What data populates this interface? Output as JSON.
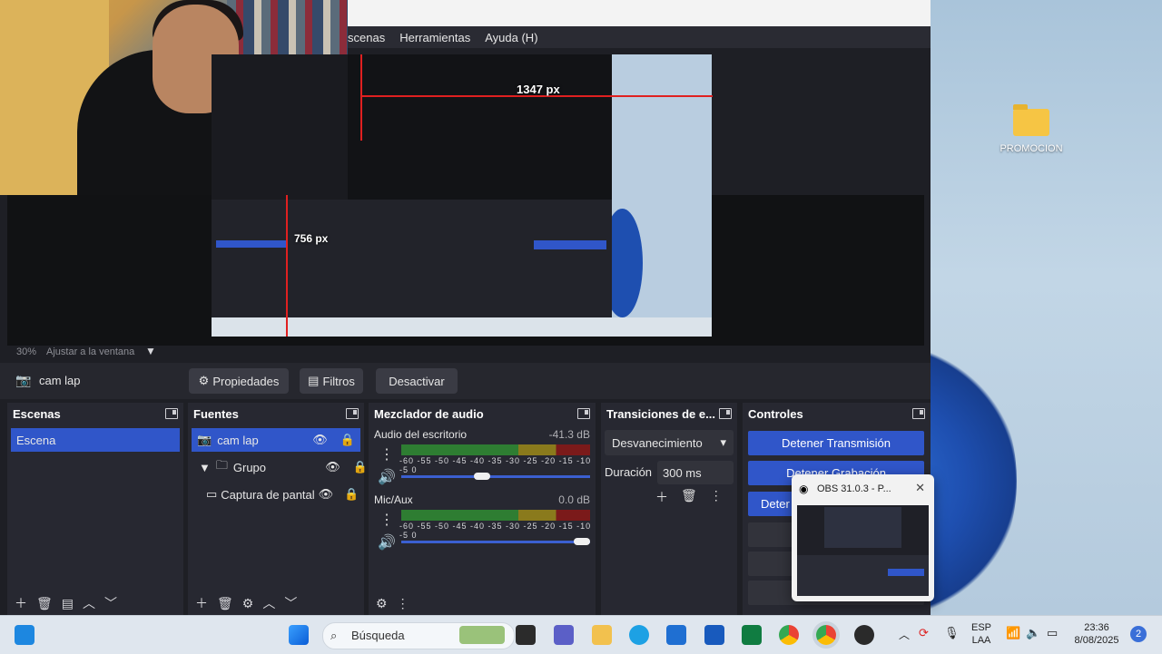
{
  "desktop": {
    "folder_label": "PROMOCION"
  },
  "menu": {
    "items": [
      "scenas",
      "Herramientas",
      "Ayuda (H)"
    ]
  },
  "preview": {
    "measure_width": "1347 px",
    "measure_height": "756 px"
  },
  "zoom": {
    "percent": "30%",
    "fit_label": "Ajustar a la ventana"
  },
  "source_bar": {
    "source_name": "cam lap",
    "properties": "Propiedades",
    "filters": "Filtros",
    "deactivate": "Desactivar"
  },
  "scenes": {
    "title": "Escenas",
    "items": [
      "Escena"
    ]
  },
  "sources": {
    "title": "Fuentes",
    "items": [
      "cam lap",
      "Grupo",
      "Captura de pantal"
    ]
  },
  "mixer": {
    "title": "Mezclador de audio",
    "channels": [
      {
        "name": "Audio del escritorio",
        "level": "-41.3 dB",
        "volume_fraction": 0.42
      },
      {
        "name": "Mic/Aux",
        "level": "0.0 dB",
        "volume_fraction": 1.0
      }
    ],
    "scale": "-60 -55 -50 -45 -40 -35 -30 -25 -20 -15 -10 -5 0"
  },
  "transitions": {
    "title": "Transiciones de e...",
    "selected": "Desvanecimiento",
    "duration_label": "Duración",
    "duration_value": "300 ms"
  },
  "controls": {
    "title": "Controles",
    "stop_stream": "Detener Transmisión",
    "stop_record": "Detener Grabación",
    "third": "Deter"
  },
  "popup": {
    "title": "OBS 31.0.3 - P..."
  },
  "taskbar": {
    "search_placeholder": "Búsqueda",
    "lang_top": "ESP",
    "lang_bottom": "LAA",
    "time": "23:36",
    "date": "8/08/2025",
    "notifications": "2"
  },
  "colors": {
    "accent": "#3056c9",
    "obs_bg": "#1e1f25",
    "dock_bg": "#272831"
  }
}
